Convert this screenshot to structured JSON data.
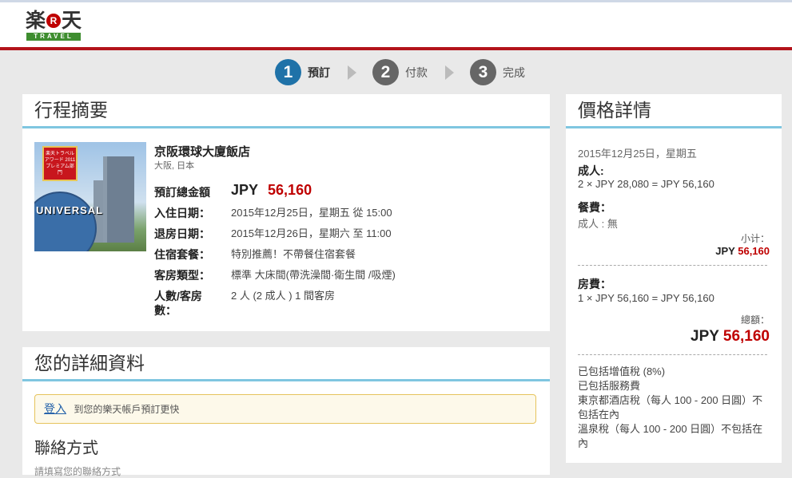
{
  "logo": {
    "main_left": "楽",
    "main_r": "R",
    "main_right": "天",
    "travel": "TRAVEL"
  },
  "steps": [
    {
      "num": "1",
      "label": "預訂"
    },
    {
      "num": "2",
      "label": "付款"
    },
    {
      "num": "3",
      "label": "完成"
    }
  ],
  "summary": {
    "title": "行程摘要",
    "image_text": "UNIVERSAL",
    "badge_text": "楽天トラベル アワード 2011 プレミアム部門",
    "hotel_name": "京阪環球大廈飯店",
    "hotel_location": "大阪, 日本",
    "total_label": "預訂總金額",
    "total_currency": "JPY",
    "total_amount": "56,160",
    "rows": [
      {
        "label": "入住日期：",
        "value": "2015年12月25日，星期五  從 15:00"
      },
      {
        "label": "退房日期：",
        "value": "2015年12月26日，星期六  至 11:00"
      },
      {
        "label": "住宿套餐：",
        "value": "特別推薦！不帶餐住宿套餐"
      },
      {
        "label": "客房類型：",
        "value": "標準 大床間(帶洗澡間·衛生間 /吸煙)"
      },
      {
        "label": "人數/客房數：",
        "value": "2  人 (2  成人 ) 1  間客房"
      }
    ]
  },
  "details": {
    "title": "您的詳細資料",
    "login_link": "登入",
    "login_text": "到您的樂天帳戶預訂更快",
    "contact_title": "聯絡方式",
    "contact_sub": "請填寫您的聯絡方式"
  },
  "price": {
    "title": "價格詳情",
    "date": "2015年12月25日，星期五",
    "adult_label": "成人:",
    "adult_calc": "2 × JPY 28,080 = JPY 56,160",
    "meal_label": "餐費：",
    "meal_value": "成人 : 無",
    "subtotal_label": "小计：",
    "subtotal_currency": "JPY",
    "subtotal_amount": "56,160",
    "room_label": "房費：",
    "room_calc": "1 × JPY  56,160 = JPY  56,160",
    "total_label": "總額：",
    "total_currency": "JPY",
    "total_amount": "56,160",
    "tax_lines": [
      "已包括增值稅 (8%)",
      "已包括服務費",
      "東京都酒店稅（每人 100 - 200 日圓）不包括在內",
      "溫泉稅（每人 100 - 200 日圓）不包括在內"
    ]
  }
}
